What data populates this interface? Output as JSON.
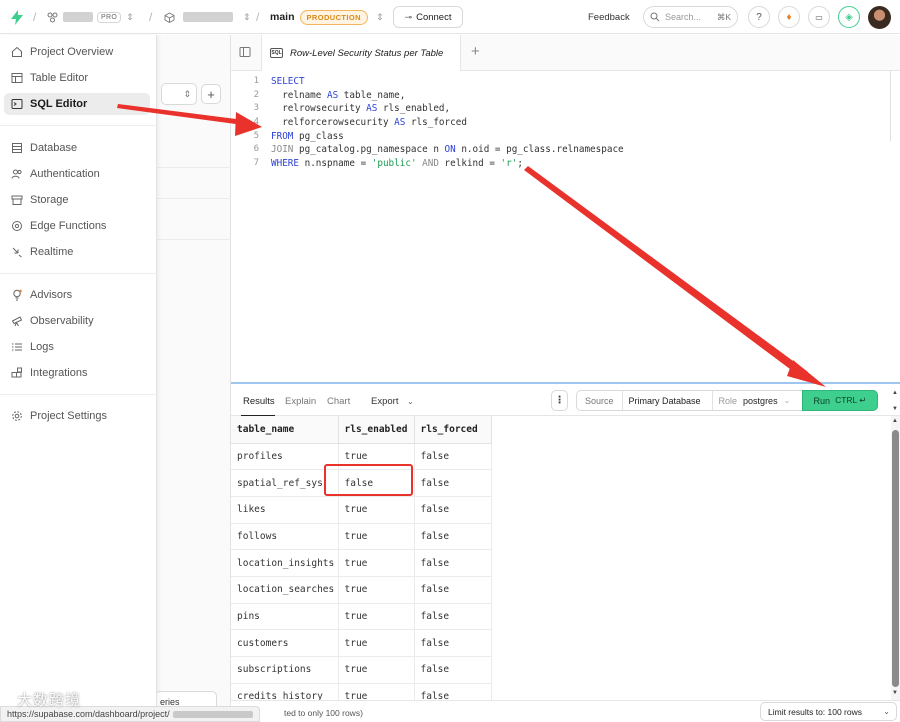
{
  "topbar": {
    "org_badge": "PRO",
    "branch": "main",
    "env_badge": "PRODUCTION",
    "connect_label": "Connect",
    "feedback_label": "Feedback",
    "search_placeholder": "Search...",
    "search_shortcut": "⌘K"
  },
  "sidebar": {
    "items": [
      {
        "label": "Project Overview",
        "icon": "home-icon"
      },
      {
        "label": "Table Editor",
        "icon": "table-icon"
      },
      {
        "label": "SQL Editor",
        "icon": "terminal-icon",
        "active": true
      },
      {
        "label": "Database",
        "icon": "database-icon"
      },
      {
        "label": "Authentication",
        "icon": "users-icon"
      },
      {
        "label": "Storage",
        "icon": "archive-icon"
      },
      {
        "label": "Edge Functions",
        "icon": "functions-icon"
      },
      {
        "label": "Realtime",
        "icon": "realtime-icon"
      },
      {
        "label": "Advisors",
        "icon": "lightbulb-icon"
      },
      {
        "label": "Observability",
        "icon": "telescope-icon"
      },
      {
        "label": "Logs",
        "icon": "list-icon"
      },
      {
        "label": "Integrations",
        "icon": "blocks-icon"
      },
      {
        "label": "Project Settings",
        "icon": "gear-icon"
      }
    ]
  },
  "queries_panel": {
    "bottom_button": "eries"
  },
  "editor": {
    "tab_title": "Row-Level Security Status per Table",
    "lines": [
      {
        "n": "1"
      },
      {
        "n": "2"
      },
      {
        "n": "3"
      },
      {
        "n": "4"
      },
      {
        "n": "5"
      },
      {
        "n": "6"
      },
      {
        "n": "7"
      }
    ]
  },
  "results": {
    "tabs": [
      "Results",
      "Explain",
      "Chart"
    ],
    "export_label": "Export",
    "source_label": "Source",
    "database_label": "Primary Database",
    "role_prefix": "Role",
    "role_value": "postgres",
    "run_label": "Run",
    "run_shortcut": "CTRL ↵",
    "columns": [
      "table_name",
      "rls_enabled",
      "rls_forced"
    ],
    "rows": [
      [
        "profiles",
        "true",
        "false"
      ],
      [
        "spatial_ref_sys",
        "false",
        "false"
      ],
      [
        "likes",
        "true",
        "false"
      ],
      [
        "follows",
        "true",
        "false"
      ],
      [
        "location_insights",
        "true",
        "false"
      ],
      [
        "location_searches",
        "true",
        "false"
      ],
      [
        "pins",
        "true",
        "false"
      ],
      [
        "customers",
        "true",
        "false"
      ],
      [
        "subscriptions",
        "true",
        "false"
      ],
      [
        "credits_history",
        "true",
        "false"
      ]
    ],
    "footer_note": "ted to only 100 rows)",
    "limit_label": "Limit results to: 100 rows"
  },
  "status_url": "https://supabase.com/dashboard/project/",
  "watermark": "大数跨境",
  "colors": {
    "run_button": "#3ecf8e",
    "annotation": "#e8322b",
    "brand": "#3ecf8e"
  }
}
